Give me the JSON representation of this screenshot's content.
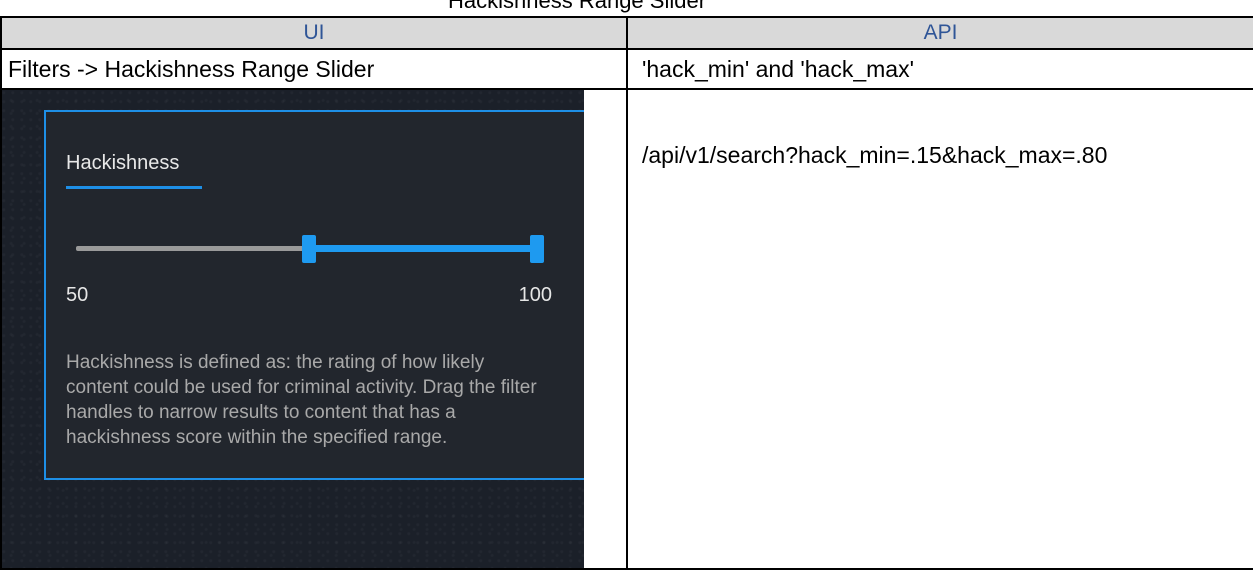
{
  "top_caption": "Hackishness Range Slider",
  "table": {
    "headers": [
      "UI",
      "API"
    ],
    "row": {
      "ui_label": "Filters -> Hackishness Range Slider",
      "api_label": "'hack_min' and 'hack_max'"
    },
    "api_example": "/api/v1/search?hack_min=.15&hack_max=.80"
  },
  "ui_screenshot": {
    "panel_title": "Hackishness",
    "slider": {
      "min_label": "50",
      "max_label": "100",
      "low_fraction": 0.5,
      "high_fraction": 1.0
    },
    "description": "Hackishness is defined as: the rating of how likely content could be used for criminal activity. Drag the filter handles to narrow results to content that has a hackishness score within the specified range."
  },
  "colors": {
    "accent": "#1e9af0",
    "header_bg": "#d9d9d9",
    "header_text": "#2f5597",
    "panel_bg": "#22262d"
  }
}
